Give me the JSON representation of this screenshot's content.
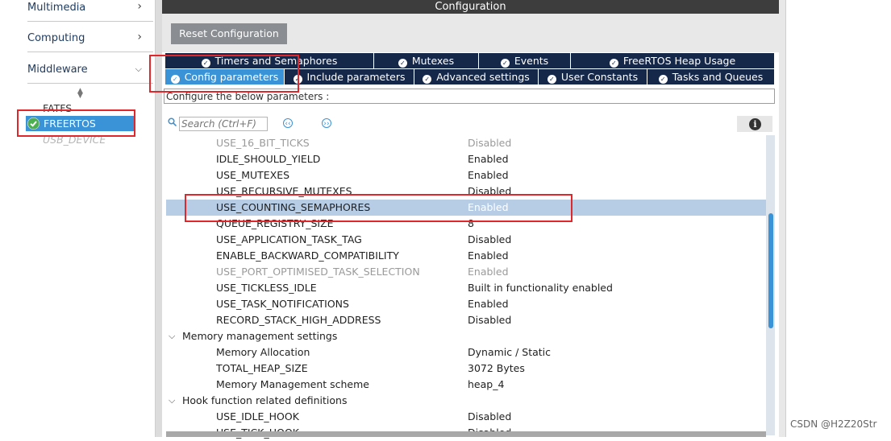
{
  "left_panel": {
    "categories": [
      {
        "label": "Multimedia",
        "chevron": ">"
      },
      {
        "label": "Computing",
        "chevron": ">"
      },
      {
        "label": "Middleware",
        "chevron": "v"
      }
    ],
    "middleware_items": [
      {
        "label": "FATFS",
        "state": "normal"
      },
      {
        "label": "FREERTOS",
        "state": "selected"
      },
      {
        "label": "USB_DEVICE",
        "state": "disabled"
      }
    ],
    "selected_check_icon": "check-circle-icon"
  },
  "config": {
    "header_title": "Configuration",
    "reset_button": "Reset Configuration",
    "tabs_row1": [
      {
        "label": "Timers and Semaphores"
      },
      {
        "label": "Mutexes"
      },
      {
        "label": "Events"
      },
      {
        "label": "FreeRTOS Heap Usage"
      }
    ],
    "tabs_row2": [
      {
        "label": "Config parameters",
        "active": true
      },
      {
        "label": "Include parameters"
      },
      {
        "label": "Advanced settings"
      },
      {
        "label": "User Constants"
      },
      {
        "label": "Tasks and Queues"
      }
    ],
    "description": "Configure the below parameters :",
    "search_placeholder": "Search (Ctrl+F)",
    "parameters": [
      {
        "type": "param",
        "name": "USE_16_BIT_TICKS",
        "value": "Disabled",
        "dim": true
      },
      {
        "type": "param",
        "name": "IDLE_SHOULD_YIELD",
        "value": "Enabled"
      },
      {
        "type": "param",
        "name": "USE_MUTEXES",
        "value": "Enabled"
      },
      {
        "type": "param",
        "name": "USE_RECURSIVE_MUTEXES",
        "value": "Disabled"
      },
      {
        "type": "param",
        "name": "USE_COUNTING_SEMAPHORES",
        "value": "Enabled",
        "selected": true
      },
      {
        "type": "param",
        "name": "QUEUE_REGISTRY_SIZE",
        "value": "8"
      },
      {
        "type": "param",
        "name": "USE_APPLICATION_TASK_TAG",
        "value": "Disabled"
      },
      {
        "type": "param",
        "name": "ENABLE_BACKWARD_COMPATIBILITY",
        "value": "Enabled"
      },
      {
        "type": "param",
        "name": "USE_PORT_OPTIMISED_TASK_SELECTION",
        "value": "Enabled",
        "dim": true
      },
      {
        "type": "param",
        "name": "USE_TICKLESS_IDLE",
        "value": "Built in functionality enabled"
      },
      {
        "type": "param",
        "name": "USE_TASK_NOTIFICATIONS",
        "value": "Enabled"
      },
      {
        "type": "param",
        "name": "RECORD_STACK_HIGH_ADDRESS",
        "value": "Disabled"
      },
      {
        "type": "group",
        "name": "Memory management settings"
      },
      {
        "type": "param",
        "name": "Memory Allocation",
        "value": "Dynamic / Static"
      },
      {
        "type": "param",
        "name": "TOTAL_HEAP_SIZE",
        "value": "3072 Bytes"
      },
      {
        "type": "param",
        "name": "Memory Management scheme",
        "value": "heap_4"
      },
      {
        "type": "group",
        "name": "Hook function related definitions"
      },
      {
        "type": "param",
        "name": "USE_IDLE_HOOK",
        "value": "Disabled"
      },
      {
        "type": "param",
        "name": "USE_TICK_HOOK",
        "value": "Disabled"
      }
    ]
  },
  "watermark": "CSDN @H2Z20Str",
  "accent_color": "#3a93d6",
  "tab_color": "#16284a",
  "highlight_color": "#e0282c"
}
